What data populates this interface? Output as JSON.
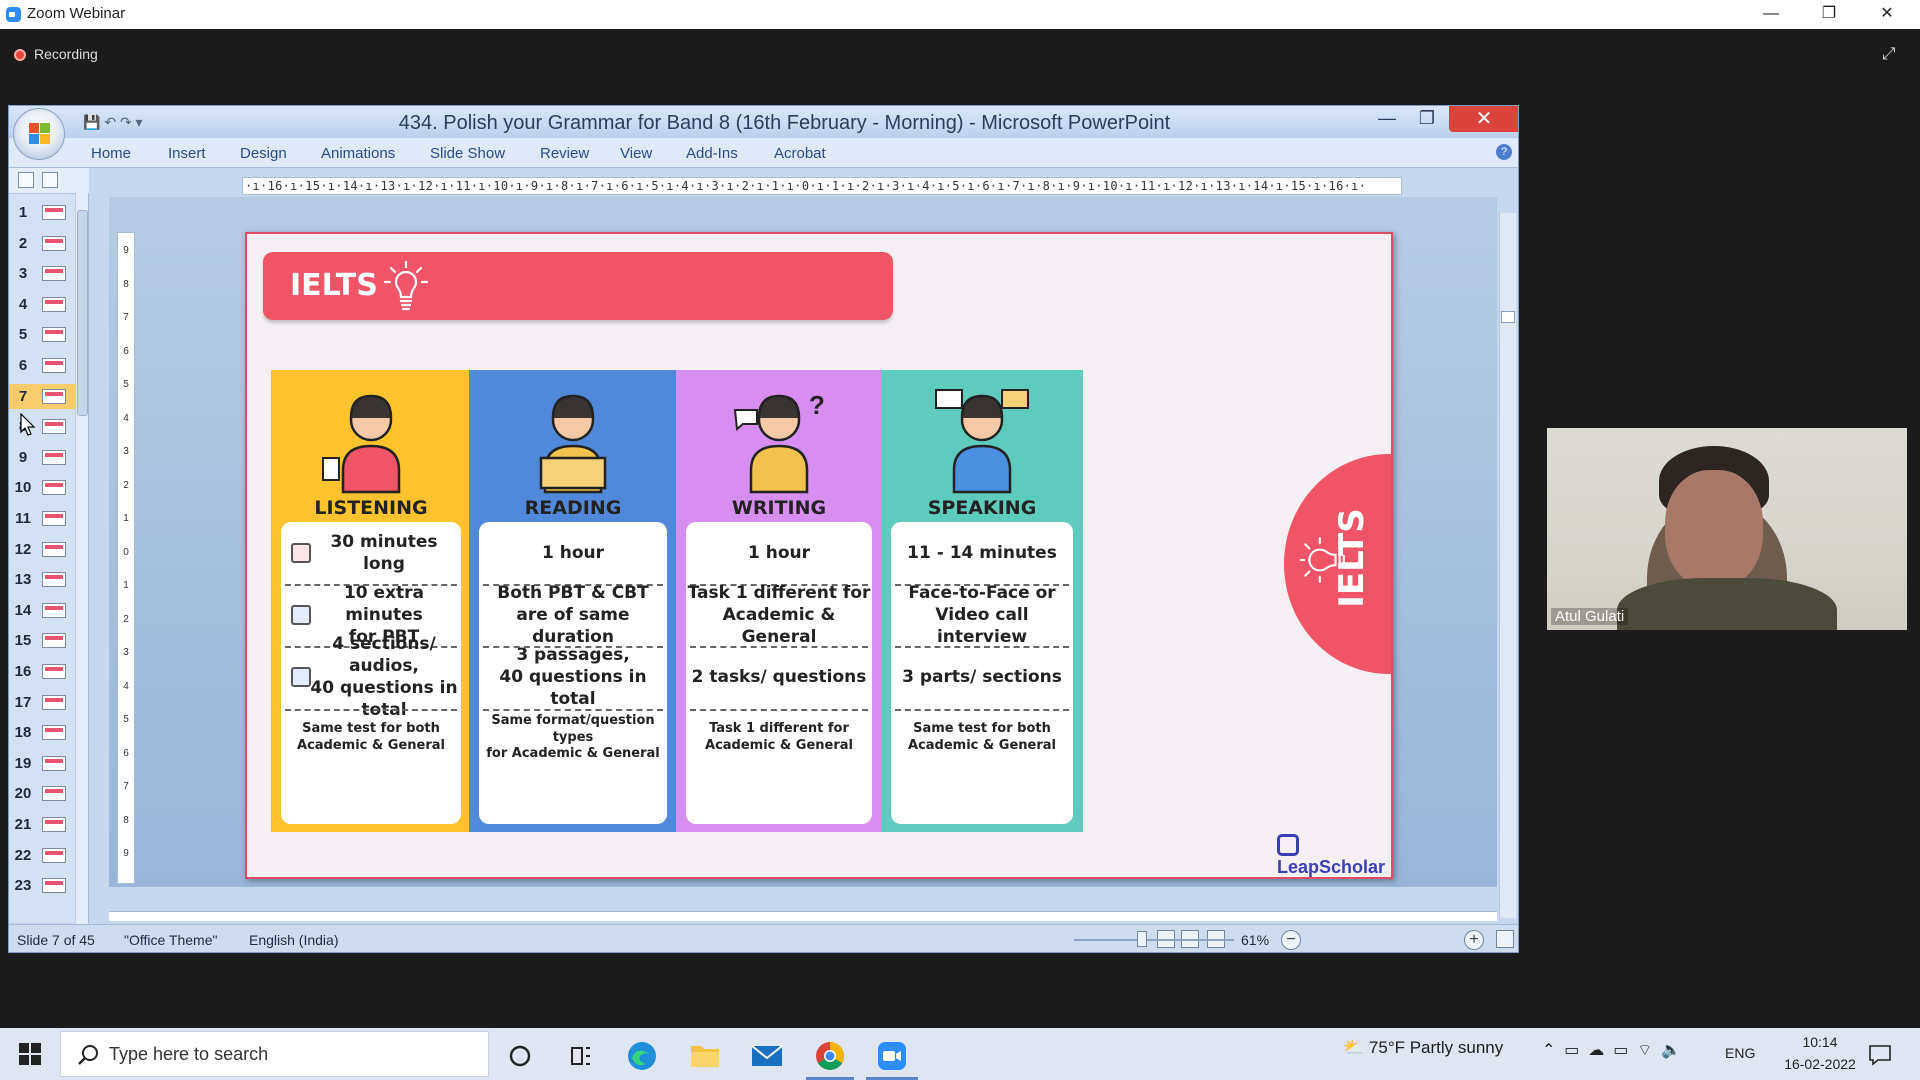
{
  "zoom": {
    "window_title": "Zoom Webinar",
    "recording_label": "Recording",
    "controls": {
      "minimize": "—",
      "restore": "❐",
      "close": "✕"
    }
  },
  "powerpoint": {
    "title": "434. Polish your Grammar for Band 8 (16th February - Morning) - Microsoft PowerPoint",
    "ribbon_tabs": [
      "Home",
      "Insert",
      "Design",
      "Animations",
      "Slide Show",
      "Review",
      "View",
      "Add-Ins",
      "Acrobat"
    ],
    "ruler_text": "·ı·16·ı·15·ı·14·ı·13·ı·12·ı·11·ı·10·ı·9·ı·8·ı·7·ı·6·ı·5·ı·4·ı·3·ı·2·ı·1·ı·0·ı·1·ı·2·ı·3·ı·4·ı·5·ı·6·ı·7·ı·8·ı·9·ı·10·ı·11·ı·12·ı·13·ı·14·ı·15·ı·16·ı·",
    "vruler_numbers": [
      "9",
      "8",
      "7",
      "6",
      "5",
      "4",
      "3",
      "2",
      "1",
      "0",
      "1",
      "2",
      "3",
      "4",
      "5",
      "6",
      "7",
      "8",
      "9"
    ],
    "slide_numbers": [
      "1",
      "2",
      "3",
      "4",
      "5",
      "6",
      "7",
      "8",
      "9",
      "10",
      "11",
      "12",
      "13",
      "14",
      "15",
      "16",
      "17",
      "18",
      "19",
      "20",
      "21",
      "22",
      "23"
    ],
    "selected_slide": "7",
    "status": {
      "slide": "Slide 7 of 45",
      "theme": "\"Office Theme\"",
      "language": "English (India)",
      "zoom": "61%"
    }
  },
  "slide": {
    "banner_title": "IELTS",
    "side_badge": "IELTS",
    "brand": "LeapScholar",
    "columns": [
      {
        "title": "LISTENING",
        "color": "#fdc32e",
        "rows": [
          "30 minutes long",
          "10 extra minutes\nfor PBT",
          "4 sections/ audios,\n40 questions in total",
          "Same test for both\nAcademic & General"
        ]
      },
      {
        "title": "READING",
        "color": "#5089d9",
        "rows": [
          "1 hour",
          "Both PBT & CBT\nare of same duration",
          "3 passages,\n40 questions in total",
          "Same format/question types\nfor Academic & General"
        ]
      },
      {
        "title": "WRITING",
        "color": "#d88ef0",
        "rows": [
          "1 hour",
          "Task 1 different for\nAcademic & General",
          "2 tasks/ questions",
          "Task 1 different for\nAcademic & General"
        ]
      },
      {
        "title": "SPEAKING",
        "color": "#5ecbbd",
        "rows": [
          "11 - 14 minutes",
          "Face-to-Face or\nVideo call interview",
          "3 parts/ sections",
          "Same test for both\nAcademic & General"
        ]
      }
    ]
  },
  "participant": {
    "name": "Atul Gulati"
  },
  "taskbar": {
    "search_placeholder": "Type here to search",
    "weather": "75°F  Partly sunny",
    "language": "ENG",
    "time": "10:14",
    "date": "16-02-2022"
  }
}
